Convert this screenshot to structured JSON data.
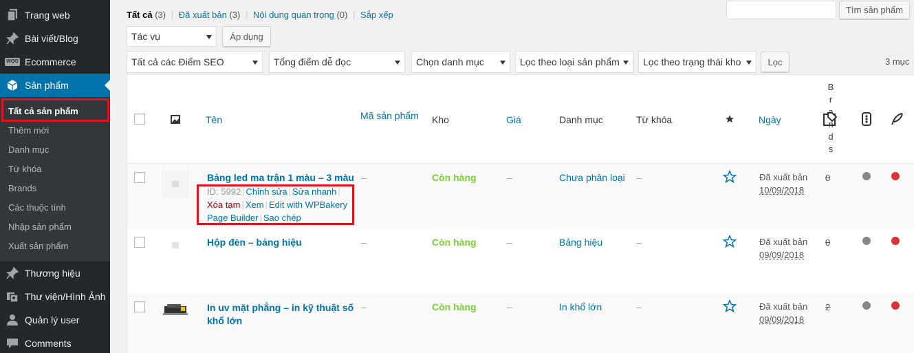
{
  "sidebar": {
    "menu": [
      {
        "label": "Trang web",
        "icon": "pages-icon"
      },
      {
        "label": "Bài viết/Blog",
        "icon": "pin-icon"
      },
      {
        "label": "Ecommerce",
        "icon": "woo-icon"
      },
      {
        "label": "Sản phẩm",
        "icon": "box-icon"
      },
      {
        "label": "Thương hiệu",
        "icon": "pin-icon"
      },
      {
        "label": "Thư viện/Hình Ảnh",
        "icon": "media-icon"
      },
      {
        "label": "Quản lý user",
        "icon": "user-icon"
      },
      {
        "label": "Comments",
        "icon": "comment-icon"
      }
    ],
    "woo_badge": "WOO",
    "submenu": [
      "Tất cả sản phẩm",
      "Thêm mới",
      "Danh mục",
      "Từ khóa",
      "Brands",
      "Các thuộc tính",
      "Nhập sản phẩm",
      "Xuất sản phẩm"
    ]
  },
  "views": {
    "all": {
      "label": "Tất cả",
      "count": "(3)"
    },
    "published": {
      "label": "Đã xuất bản",
      "count": "(3)"
    },
    "cornerstone": {
      "label": "Nội dung quan trọng",
      "count": "(0)"
    },
    "sort": {
      "label": "Sắp xếp"
    }
  },
  "search": {
    "button": "Tìm sản phẩm",
    "value": ""
  },
  "bulk": {
    "select": "Tác vụ",
    "apply": "Áp dụng"
  },
  "filters": {
    "seo": "Tất cả các Điểm SEO",
    "readability": "Tổng điểm dễ đọc",
    "category": "Chọn danh mục",
    "type": "Lọc theo loại sản phẩm",
    "stock": "Lọc theo trạng thái kho",
    "button": "Lọc"
  },
  "items_count": "3 mục",
  "columns": {
    "name": "Tên",
    "sku": "Mã sản phẩm",
    "stock": "Kho",
    "price": "Giá",
    "categories": "Danh mục",
    "tags": "Từ khóa",
    "date": "Ngày",
    "brands_letters": [
      "B",
      "r",
      "a",
      "n",
      "d",
      "s"
    ]
  },
  "products": [
    {
      "name": "Bảng led ma trận 1 màu – 3 màu",
      "name_line2": "",
      "sku": "–",
      "stock": "Còn hàng",
      "price": "–",
      "category": "Chưa phân loại",
      "tags": "–",
      "status": "Đã xuất bản",
      "date": "10/09/2018",
      "brands": "0",
      "actions": {
        "id": "ID: 5992",
        "edit": "Chỉnh sửa",
        "quick_edit": "Sửa nhanh",
        "trash": "Xóa tạm",
        "view": "Xem",
        "wpbakery": "Edit with WPBakery",
        "wpbakery2": "Page Builder",
        "duplicate": "Sao chép"
      }
    },
    {
      "name": "Hộp đèn – bảng hiệu",
      "name_line2": "",
      "sku": "–",
      "stock": "Còn hàng",
      "price": "–",
      "category": "Bảng hiệu",
      "tags": "–",
      "status": "Đã xuất bản",
      "date": "09/09/2018",
      "brands": "0"
    },
    {
      "name": "In uv mặt phẳng – in kỹ thuật số",
      "name_line2": "khổ lớn",
      "sku": "–",
      "stock": "Còn hàng",
      "price": "–",
      "category": "In khổ lớn",
      "tags": "–",
      "status": "Đã xuất bản",
      "date": "09/09/2018",
      "brands": "2"
    }
  ],
  "colors": {
    "sidebar_bg": "#23282d",
    "active_blue": "#0073aa",
    "in_stock": "#7ad03a",
    "seo_red": "#dc3232",
    "readability_gray": "#888888",
    "highlight_red": "#e0131e"
  }
}
